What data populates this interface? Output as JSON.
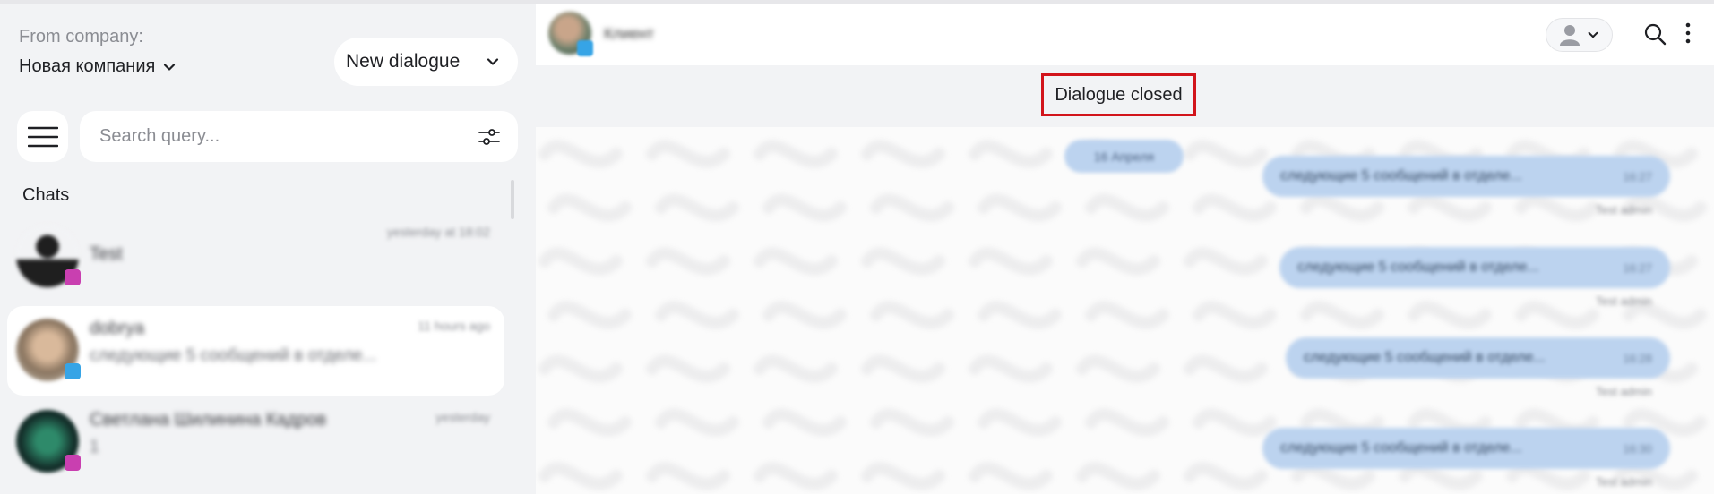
{
  "sidebar": {
    "from_label": "From company:",
    "company_name": "Новая компания",
    "new_dialogue_label": "New dialogue",
    "search_placeholder": "Search query...",
    "chats_title": "Chats",
    "chats": [
      {
        "name": "Test",
        "time": "yesterday at 18:02",
        "preview": "",
        "avatar_color": "#1f1f1f",
        "badge_color": "#c93fb0"
      },
      {
        "name": "dobrya",
        "time": "11 hours ago",
        "preview": "следующие 5 сообщений в отделе...",
        "avatar_color": "#b7a38d",
        "badge_color": "#36a4e6"
      },
      {
        "name": "Светлана Шилинина Кадров",
        "time": "yesterday",
        "preview": "1",
        "avatar_color": "#1d3a34",
        "badge_color": "#c93fb0"
      }
    ]
  },
  "chat_header": {
    "contact_name": "Клиент"
  },
  "status_banner": "Dialogue closed",
  "messages": {
    "date_label": "16 Апреля",
    "items": [
      {
        "text": "следующие 5 сообщений в отделе...",
        "time": "16:27",
        "meta": "Test admin"
      },
      {
        "text": "следующие 5 сообщений в отделе...",
        "time": "16:27",
        "meta": "Test admin"
      },
      {
        "text": "следующие 5 сообщений в отделе...",
        "time": "16:28",
        "meta": "Test admin"
      },
      {
        "text": "следующие 5 сообщений в отделе...",
        "time": "16:30",
        "meta": "Test admin"
      }
    ]
  },
  "colors": {
    "accent_bubble": "#bcd3ef",
    "highlight_border": "#d2141b",
    "panel_bg": "#f2f3f5"
  }
}
